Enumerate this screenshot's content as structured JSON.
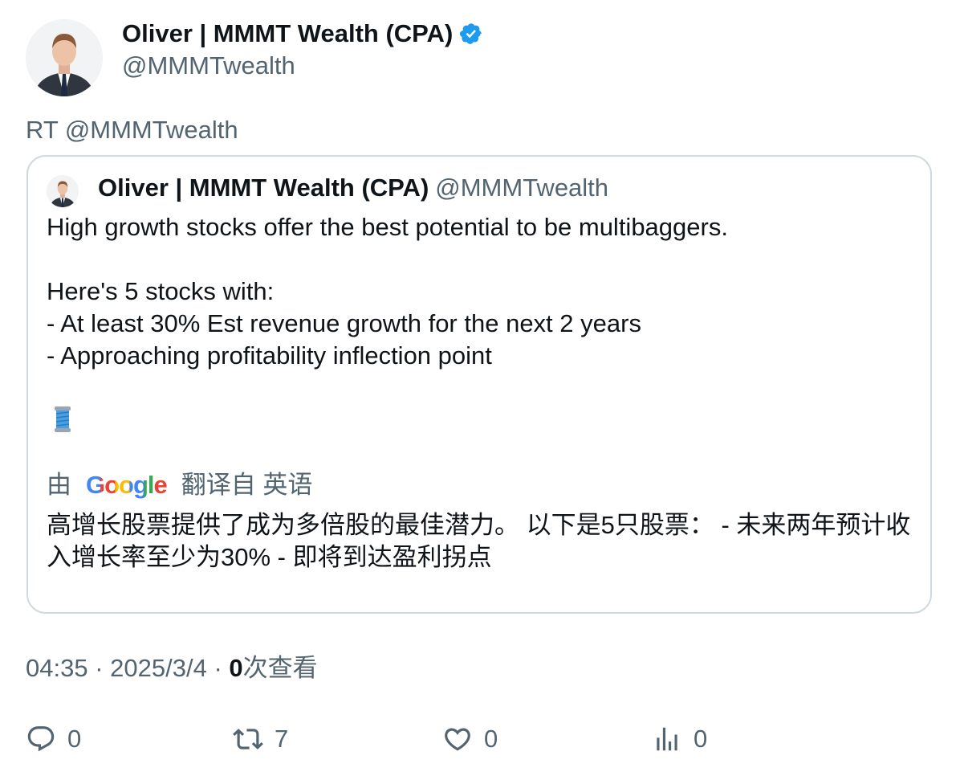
{
  "author": {
    "display_name": "Oliver | MMMT Wealth (CPA)",
    "handle": "@MMMTwealth",
    "verified_icon": "verified-badge-icon"
  },
  "retweet_line": "RT @MMMTwealth",
  "quoted": {
    "display_name": "Oliver | MMMT Wealth (CPA)",
    "handle": "@MMMTwealth",
    "lines": [
      "High growth stocks offer the best potential to be multibaggers.",
      "",
      "Here's 5 stocks with:",
      "- At least 30% Est revenue growth for the next 2 years",
      "- Approaching profitability inflection point"
    ],
    "thread_emoji": "🧵",
    "translation_prefix": "由",
    "translation_brand": "Google",
    "translation_suffix": "翻译自 英语",
    "translated_text": "高增长股票提供了成为多倍股的最佳潜力。 以下是5只股票： - 未来两年预计收入增长率至少为30% - 即将到达盈利拐点"
  },
  "meta": {
    "time": "04:35",
    "separator": "·",
    "date": "2025/3/4",
    "views_count": "0",
    "views_label": "次查看"
  },
  "actions": {
    "reply_count": "0",
    "retweet_count": "7",
    "like_count": "0",
    "views_count": "0"
  },
  "colors": {
    "text": "#0f1419",
    "secondary": "#536471",
    "border": "#cfd9de",
    "verified": "#1d9bf0"
  }
}
